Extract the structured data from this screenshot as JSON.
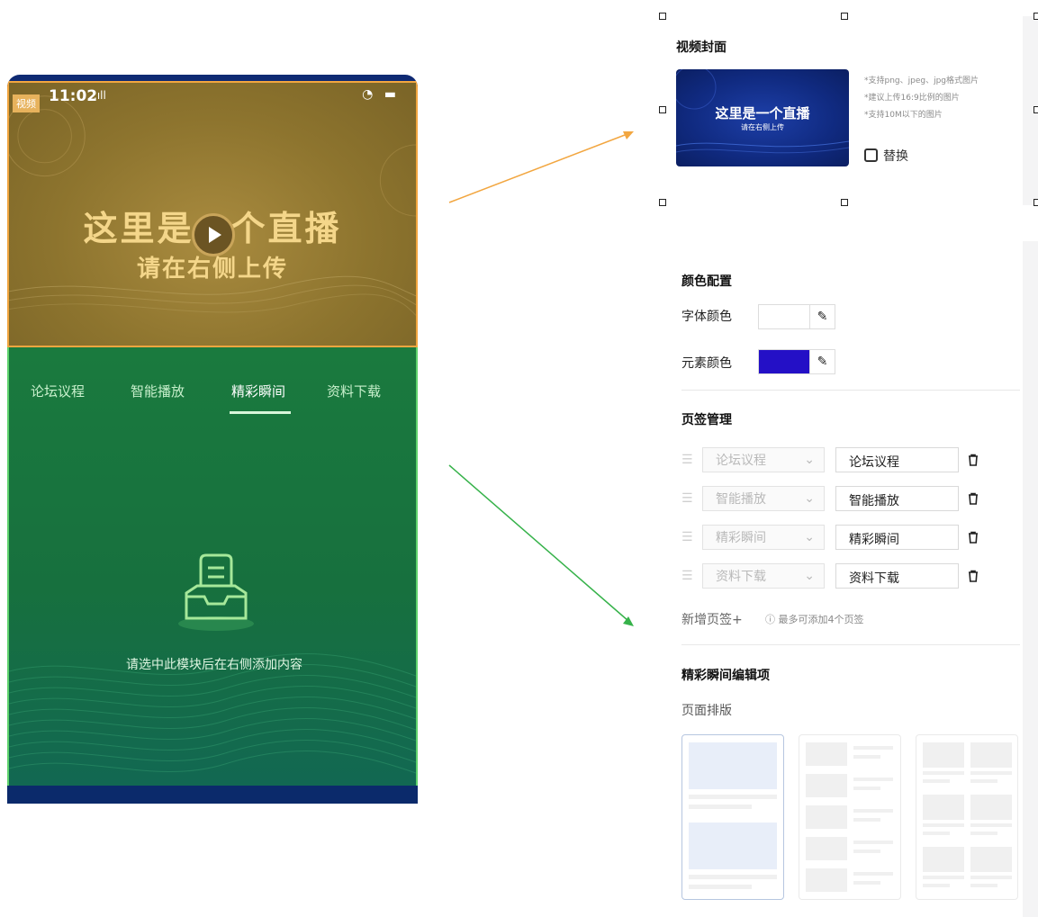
{
  "phone": {
    "status_time": "11:02",
    "video_tag": "视频",
    "live_title": "这里是一个直播",
    "live_subtitle": "请在右侧上传",
    "tabs": [
      {
        "label": "论坛议程",
        "active": false
      },
      {
        "label": "智能播放",
        "active": false
      },
      {
        "label": "精彩瞬间",
        "active": true
      },
      {
        "label": "资料下载",
        "active": false
      }
    ],
    "empty_text": "请选中此模块后在右侧添加内容",
    "colors": {
      "video_highlight": "#f2a640",
      "tabs_highlight": "#5fd36d"
    }
  },
  "cover_panel": {
    "title": "视频封面",
    "image_title": "这里是一个直播",
    "image_subtitle": "请在右侧上传",
    "notes": [
      "*支持png、jpeg、jpg格式图片",
      "*建议上传16:9比例的图片",
      "*支持10M以下的图片"
    ],
    "replace_label": "替换",
    "replace_icon": "replace-icon"
  },
  "color_config": {
    "title": "颜色配置",
    "font_color_label": "字体颜色",
    "font_color": "#ffffff",
    "element_color_label": "元素颜色",
    "element_color": "#2410c6",
    "picker_icon": "eyedropper-icon"
  },
  "tab_manage": {
    "title": "页签管理",
    "rows": [
      {
        "select": "论坛议程",
        "input": "论坛议程"
      },
      {
        "select": "智能播放",
        "input": "智能播放"
      },
      {
        "select": "精彩瞬间",
        "input": "精彩瞬间"
      },
      {
        "select": "资料下载",
        "input": "资料下载"
      }
    ],
    "add_label": "新增页签+",
    "add_note": "最多可添加4个页签"
  },
  "highlight_edit": {
    "title": "精彩瞬间编辑项",
    "layout_label": "页面排版",
    "selected_layout": 1
  }
}
